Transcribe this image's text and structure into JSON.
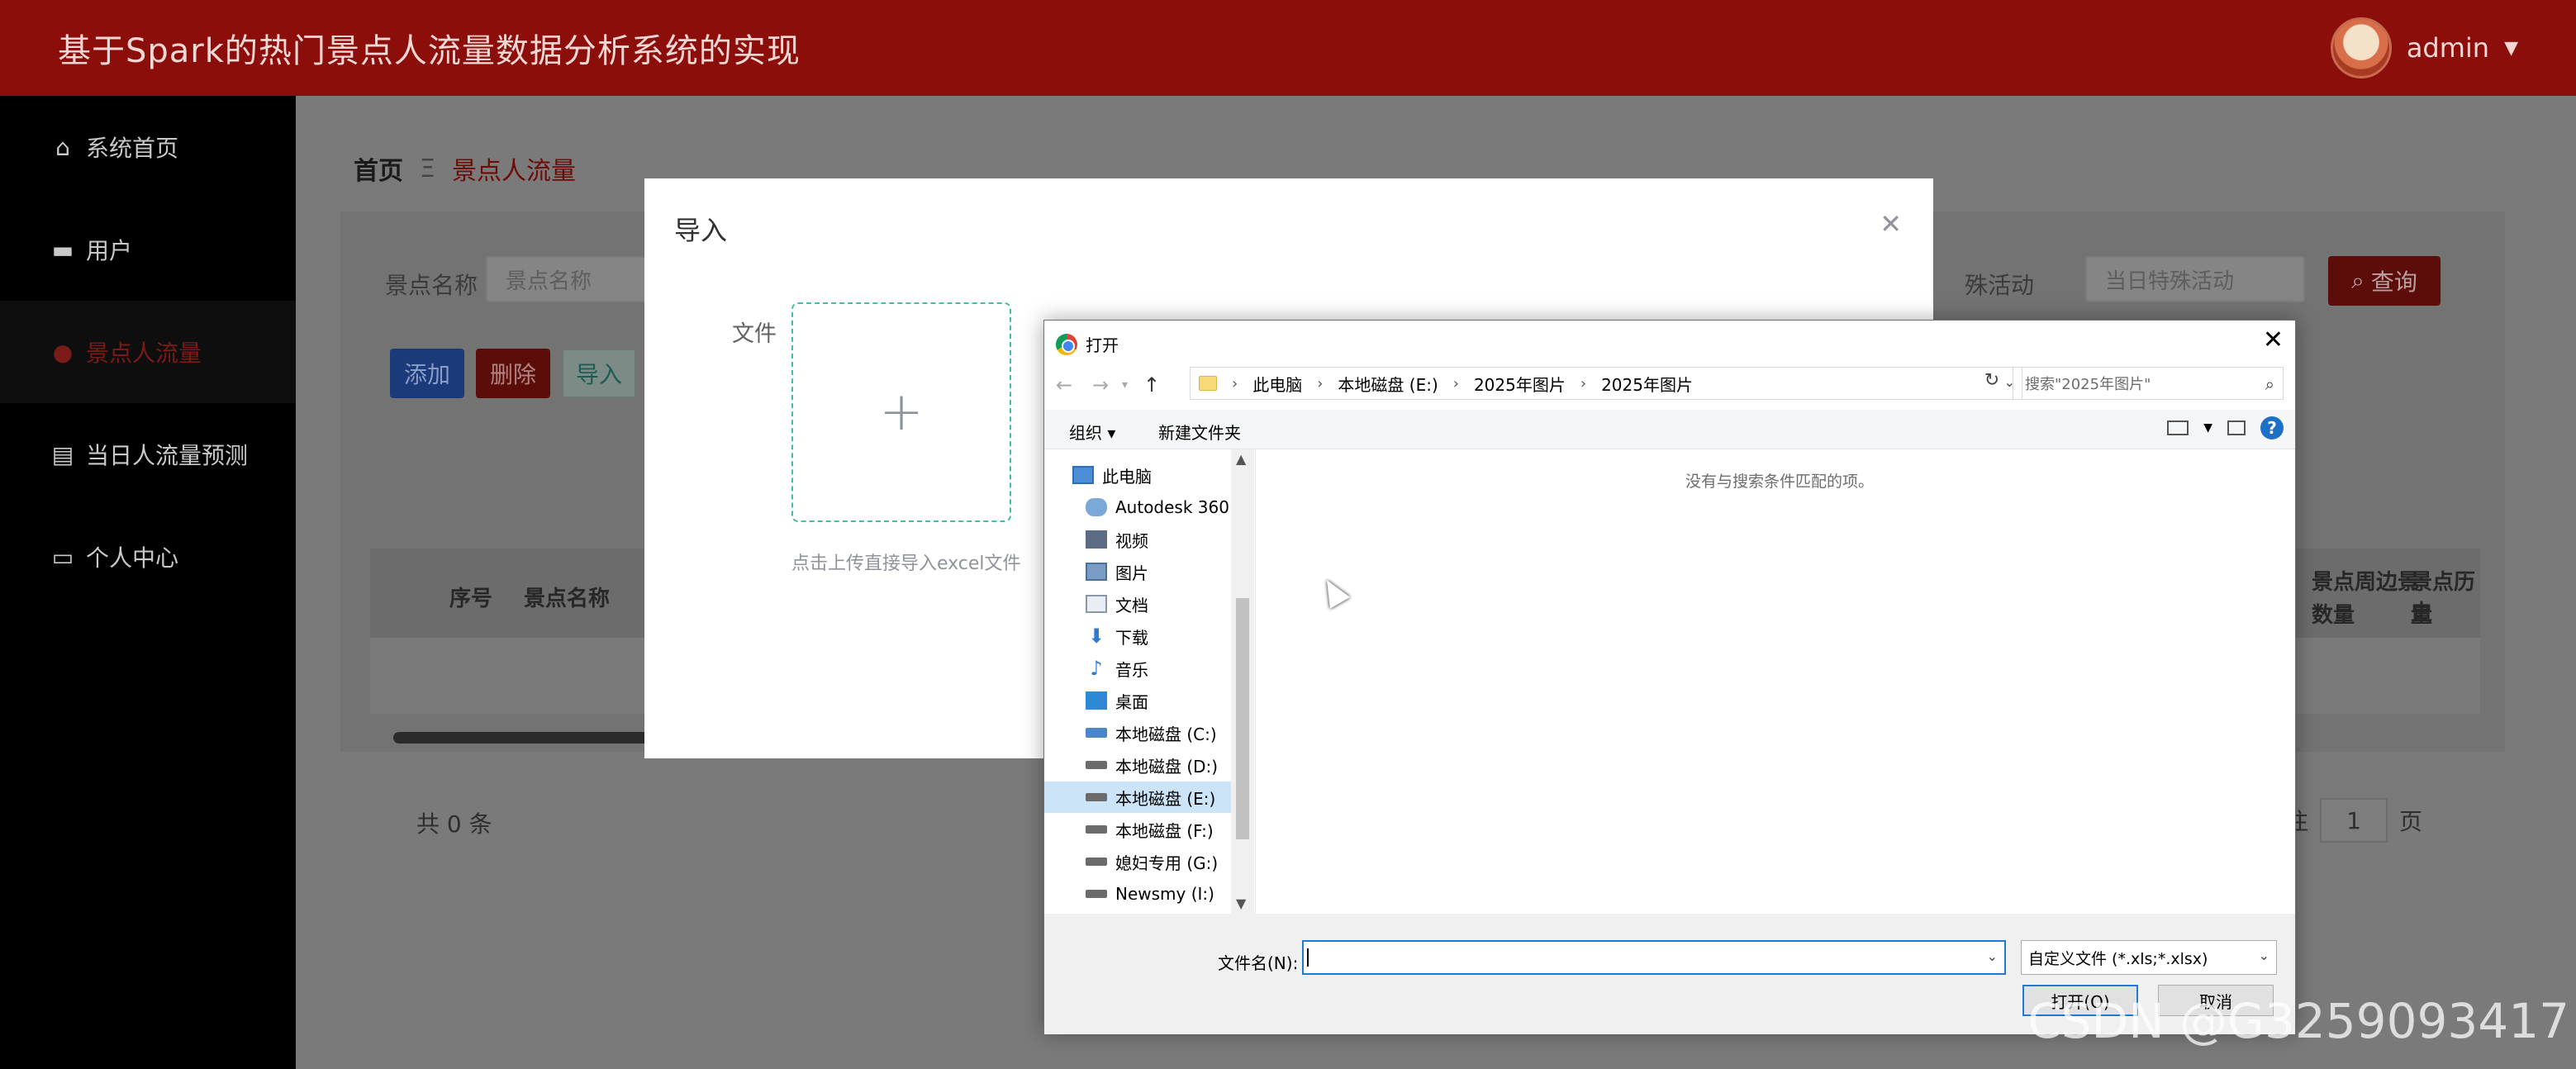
{
  "app": {
    "title": "基于Spark的热门景点人流量数据分析系统的实现",
    "user": "admin"
  },
  "sidebar": {
    "items": [
      {
        "label": "系统首页",
        "icon": "home-icon"
      },
      {
        "label": "用户",
        "icon": "briefcase-icon"
      },
      {
        "label": "景点人流量",
        "icon": "user-icon",
        "active": true
      },
      {
        "label": "当日人流量预测",
        "icon": "clipboard-icon"
      },
      {
        "label": "个人中心",
        "icon": "card-icon"
      }
    ]
  },
  "breadcrumb": {
    "home": "首页",
    "separator": "Ξ",
    "current": "景点人流量"
  },
  "search": {
    "label_name": "景点名称",
    "placeholder_name": "景点名称",
    "label_event": "殊活动",
    "placeholder_event": "当日特殊活动",
    "query_label": "查询"
  },
  "actions": {
    "add": "添加",
    "delete": "删除",
    "import": "导入"
  },
  "table": {
    "columns": [
      "序号",
      "景点名称",
      "景点周边景点数量",
      "景点历史人流量"
    ],
    "col3_line1": "景点周边景",
    "col3_line2": "数量",
    "col4_line1": "景点历史",
    "col4_line2": "量"
  },
  "pagination": {
    "total": "共 0 条",
    "goto_prefix": "前往",
    "page": "1",
    "goto_suffix": "页"
  },
  "import_dialog": {
    "title": "导入",
    "file_label": "文件",
    "upload_tip": "点击上传直接导入excel文件"
  },
  "open_dialog": {
    "title": "打开",
    "path": [
      "此电脑",
      "本地磁盘 (E:)",
      "2025年图片",
      "2025年图片"
    ],
    "search_placeholder": "搜索\"2025年图片\"",
    "organize": "组织 ▾",
    "new_folder": "新建文件夹",
    "tree": [
      {
        "label": "此电脑",
        "icon": "pc-icon"
      },
      {
        "label": "Autodesk 360",
        "icon": "cloud-icon"
      },
      {
        "label": "视频",
        "icon": "video-icon"
      },
      {
        "label": "图片",
        "icon": "picture-icon"
      },
      {
        "label": "文档",
        "icon": "document-icon"
      },
      {
        "label": "下载",
        "icon": "download-icon"
      },
      {
        "label": "音乐",
        "icon": "music-icon"
      },
      {
        "label": "桌面",
        "icon": "desktop-icon"
      },
      {
        "label": "本地磁盘 (C:)",
        "icon": "system-drive-icon"
      },
      {
        "label": "本地磁盘 (D:)",
        "icon": "drive-icon"
      },
      {
        "label": "本地磁盘 (E:)",
        "icon": "drive-icon",
        "selected": true
      },
      {
        "label": "本地磁盘 (F:)",
        "icon": "drive-icon"
      },
      {
        "label": "媳妇专用 (G:)",
        "icon": "drive-icon"
      },
      {
        "label": "Newsmy (I:)",
        "icon": "drive-icon"
      }
    ],
    "empty_message": "没有与搜索条件匹配的项。",
    "filename_label": "文件名(N):",
    "filename_value": "",
    "file_type": "自定义文件 (*.xls;*.xlsx)",
    "open_button": "打开(O)",
    "cancel_button": "取消"
  },
  "watermark": "CSDN @G3259093417"
}
